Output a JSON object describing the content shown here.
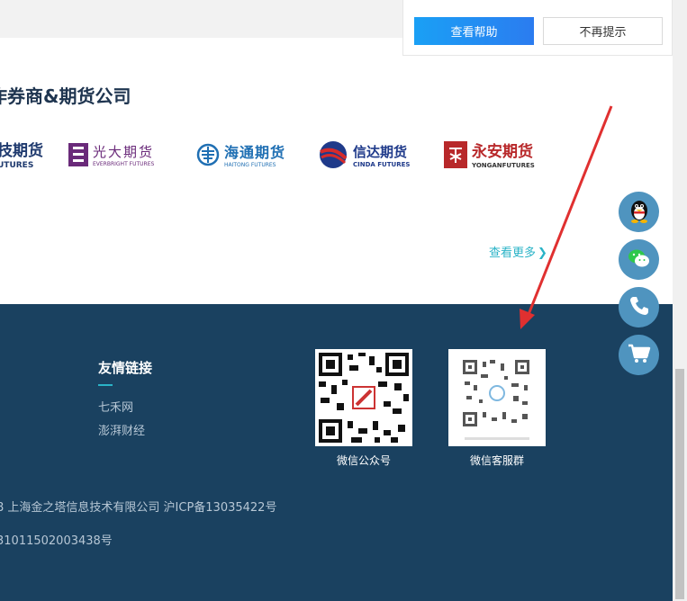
{
  "help_popup": {
    "help_button": "查看帮助",
    "noremind_button": "不再提示"
  },
  "section": {
    "title": "作券商&期货公司"
  },
  "logos": [
    {
      "cn": "技期货",
      "en": "UTURES"
    },
    {
      "cn": "光大期货",
      "en": "EVERBRIGHT FUTURES"
    },
    {
      "cn": "海通期货",
      "en": "HAITONG FUTURES"
    },
    {
      "cn": "信达期货",
      "en": "CINDA FUTURES"
    },
    {
      "cn": "永安期货",
      "en": "YONGANFUTURES"
    }
  ],
  "more_link": {
    "label": "查看更多"
  },
  "footer": {
    "friend_title": "友情链接",
    "friend_links": [
      "七禾网",
      "澎湃财经"
    ],
    "qr_labels": [
      "微信公众号",
      "微信客服群"
    ],
    "copyright": "8 上海金之塔信息技术有限公司    沪ICP备13035422号",
    "beian": "31011502003438号"
  },
  "colors": {
    "footer_bg": "#1a4160",
    "accent": "#2ab3c7",
    "help_button": "#1aa0f5",
    "side_button": "#4f94bf"
  },
  "icons": {
    "side_buttons": [
      "qq-penguin-icon",
      "wechat-icon",
      "phone-icon",
      "cart-icon"
    ],
    "annotation": "red-arrow"
  }
}
